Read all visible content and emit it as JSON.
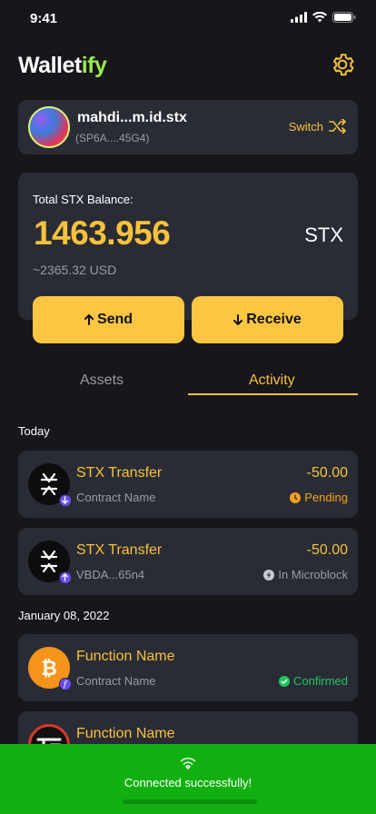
{
  "status": {
    "time": "9:41"
  },
  "header": {
    "logo_main": "Wallet",
    "logo_accent": "ify"
  },
  "account": {
    "name": "mahdi...m.id.stx",
    "address": "(SP6A....45G4)",
    "switch_label": "Switch"
  },
  "balance": {
    "label": "Total STX Balance:",
    "value": "1463.956",
    "currency": "STX",
    "usd": "~2365.32 USD"
  },
  "actions": {
    "send_label": "Send",
    "receive_label": "Receive"
  },
  "tabs": [
    {
      "label": "Assets",
      "active": false
    },
    {
      "label": "Activity",
      "active": true
    }
  ],
  "sections": [
    "Today",
    "January 08, 2022"
  ],
  "transactions": [
    {
      "title": "STX Transfer",
      "subtitle": "Contract Name",
      "amount": "-50.00",
      "status": "Pending",
      "status_color": "#f7a21b",
      "icon": "stacks-icon",
      "direction": "in"
    },
    {
      "title": "STX Transfer",
      "subtitle": "VBDA...65n4",
      "amount": "-50.00",
      "status": "In Microblock",
      "status_color": "#9a9ba3",
      "icon": "stacks-icon",
      "direction": "out"
    },
    {
      "title": "Function Name",
      "subtitle": "Contract Name",
      "amount": "",
      "status": "Confirmed",
      "status_color": "#22c55e",
      "icon": "bitcoin-icon",
      "direction": "function"
    },
    {
      "title": "Function Name",
      "subtitle": "",
      "amount": "",
      "status": "",
      "status_color": "",
      "icon": "token-icon",
      "direction": "function"
    }
  ],
  "toast": {
    "message": "Connected successfully!"
  },
  "colors": {
    "accent": "#f7c23b",
    "background": "#16161b",
    "card": "#2a2c35",
    "success": "#11b010",
    "logo_accent": "#9ae94a"
  }
}
